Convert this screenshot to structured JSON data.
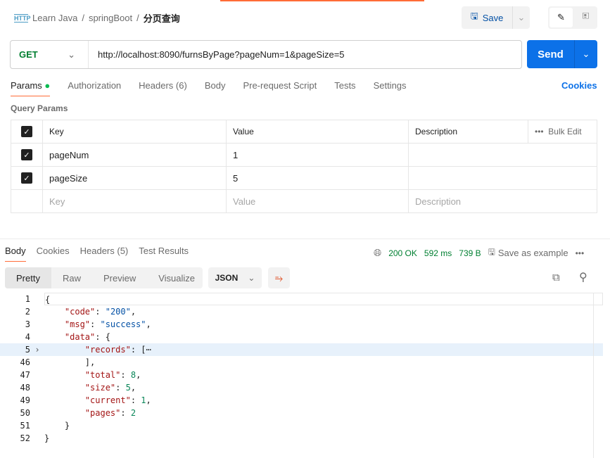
{
  "breadcrumb": {
    "items": [
      "Learn Java",
      "springBoot"
    ],
    "current": "分页查询",
    "sep": "/"
  },
  "toolbar": {
    "save_label": "Save"
  },
  "request": {
    "method": "GET",
    "url": "http://localhost:8090/furnsByPage?pageNum=1&pageSize=5",
    "send_label": "Send"
  },
  "req_tabs": [
    {
      "label": "Params",
      "active": true
    },
    {
      "label": "Authorization"
    },
    {
      "label": "Headers (6)"
    },
    {
      "label": "Body"
    },
    {
      "label": "Pre-request Script"
    },
    {
      "label": "Tests"
    },
    {
      "label": "Settings"
    }
  ],
  "cookies_label": "Cookies",
  "query_params": {
    "title": "Query Params",
    "headers": {
      "key": "Key",
      "value": "Value",
      "description": "Description",
      "bulk": "Bulk Edit"
    },
    "rows": [
      {
        "key": "pageNum",
        "value": "1",
        "checked": true
      },
      {
        "key": "pageSize",
        "value": "5",
        "checked": true
      }
    ],
    "placeholder": {
      "key": "Key",
      "value": "Value",
      "description": "Description"
    }
  },
  "res_tabs": [
    {
      "label": "Body",
      "active": true
    },
    {
      "label": "Cookies"
    },
    {
      "label": "Headers (5)"
    },
    {
      "label": "Test Results"
    }
  ],
  "status": {
    "code": "200 OK",
    "time": "592 ms",
    "size": "739 B",
    "save_example": "Save as example"
  },
  "view_modes": [
    "Pretty",
    "Raw",
    "Preview",
    "Visualize"
  ],
  "format": "JSON",
  "colors": {
    "accent": "#ff6c37",
    "send": "#0c71e8",
    "key": "#a31515",
    "string": "#0451a5",
    "number": "#098658"
  },
  "code_lines": [
    {
      "n": "1",
      "tokens": [
        [
          "p",
          "{"
        ]
      ]
    },
    {
      "n": "2",
      "tokens": [
        [
          "p",
          "    "
        ],
        [
          "k",
          "\"code\""
        ],
        [
          "p",
          ": "
        ],
        [
          "s",
          "\"200\""
        ],
        [
          "p",
          ","
        ]
      ]
    },
    {
      "n": "3",
      "tokens": [
        [
          "p",
          "    "
        ],
        [
          "k",
          "\"msg\""
        ],
        [
          "p",
          ": "
        ],
        [
          "s",
          "\"success\""
        ],
        [
          "p",
          ","
        ]
      ]
    },
    {
      "n": "4",
      "tokens": [
        [
          "p",
          "    "
        ],
        [
          "k",
          "\"data\""
        ],
        [
          "p",
          ": {"
        ]
      ]
    },
    {
      "n": "5",
      "fold": true,
      "tokens": [
        [
          "p",
          "        "
        ],
        [
          "k",
          "\"records\""
        ],
        [
          "p",
          ": [⋯"
        ]
      ]
    },
    {
      "n": "46",
      "tokens": [
        [
          "p",
          "        ],"
        ]
      ]
    },
    {
      "n": "47",
      "tokens": [
        [
          "p",
          "        "
        ],
        [
          "k",
          "\"total\""
        ],
        [
          "p",
          ": "
        ],
        [
          "num",
          "8"
        ],
        [
          "p",
          ","
        ]
      ]
    },
    {
      "n": "48",
      "tokens": [
        [
          "p",
          "        "
        ],
        [
          "k",
          "\"size\""
        ],
        [
          "p",
          ": "
        ],
        [
          "num",
          "5"
        ],
        [
          "p",
          ","
        ]
      ]
    },
    {
      "n": "49",
      "tokens": [
        [
          "p",
          "        "
        ],
        [
          "k",
          "\"current\""
        ],
        [
          "p",
          ": "
        ],
        [
          "num",
          "1"
        ],
        [
          "p",
          ","
        ]
      ]
    },
    {
      "n": "50",
      "tokens": [
        [
          "p",
          "        "
        ],
        [
          "k",
          "\"pages\""
        ],
        [
          "p",
          ": "
        ],
        [
          "num",
          "2"
        ]
      ]
    },
    {
      "n": "51",
      "tokens": [
        [
          "p",
          "    }"
        ]
      ]
    },
    {
      "n": "52",
      "tokens": [
        [
          "p",
          "}"
        ]
      ]
    }
  ]
}
